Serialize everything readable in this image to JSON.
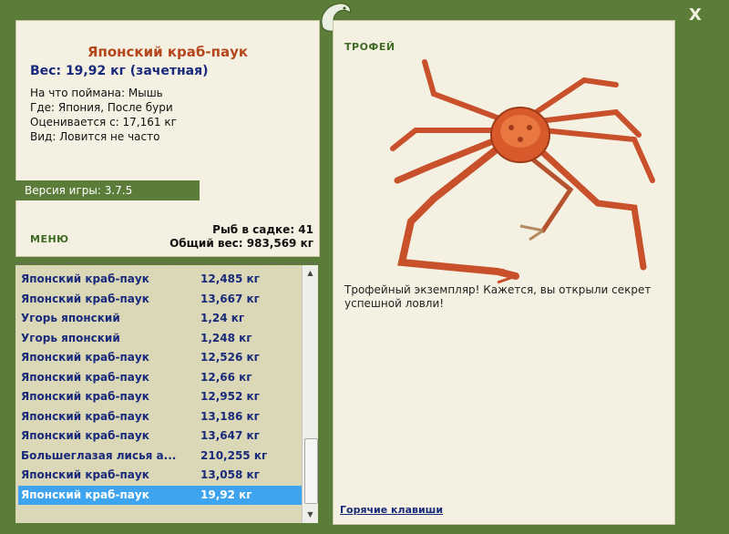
{
  "window": {
    "close_label": "X",
    "logo_icon": "fish-logo-icon"
  },
  "current_catch": {
    "title": "Японский краб-паук",
    "weight": "Вес: 19,92 кг (зачетная)",
    "bait": "На что поймана: Мышь",
    "location": "Где: Япония, После бури",
    "rated_from": "Оценивается с: 17,161 кг",
    "frequency": "Вид: Ловится не часто"
  },
  "version": "Версия игры: 3.7.5",
  "menu_label": "МЕНЮ",
  "keepnet": {
    "count": "Рыб в садке: 41",
    "total_weight": "Общий вес: 983,569 кг"
  },
  "catch_list": [
    {
      "name": "Японский краб-паук",
      "weight": "12,485 кг"
    },
    {
      "name": "Японский краб-паук",
      "weight": "13,667 кг"
    },
    {
      "name": "Угорь японский",
      "weight": "1,24 кг"
    },
    {
      "name": "Угорь японский",
      "weight": "1,248 кг"
    },
    {
      "name": "Японский краб-паук",
      "weight": "12,526 кг"
    },
    {
      "name": "Японский краб-паук",
      "weight": "12,66 кг"
    },
    {
      "name": "Японский краб-паук",
      "weight": "12,952 кг"
    },
    {
      "name": "Японский краб-паук",
      "weight": "13,186 кг"
    },
    {
      "name": "Японский краб-паук",
      "weight": "13,647 кг"
    },
    {
      "name": "Большеглазая лисья а...",
      "weight": "210,255 кг"
    },
    {
      "name": "Японский краб-паук",
      "weight": "13,058 кг"
    },
    {
      "name": "Японский краб-паук",
      "weight": "19,92 кг"
    }
  ],
  "selected_index": 11,
  "trophy": {
    "label": "ТРОФЕЙ",
    "text": "Трофейный экземпляр! Кажется, вы открыли секрет успешной ловли!",
    "image_icon": "spider-crab-image"
  },
  "hotkeys_label": "Горячие клавиши",
  "colors": {
    "frame": "#5b7d39",
    "panel": "#f4f1e2",
    "list_bg": "#dbd8b8",
    "title": "#b5461c",
    "text_blue": "#1a2a7a",
    "selected": "#3fa4f0"
  }
}
